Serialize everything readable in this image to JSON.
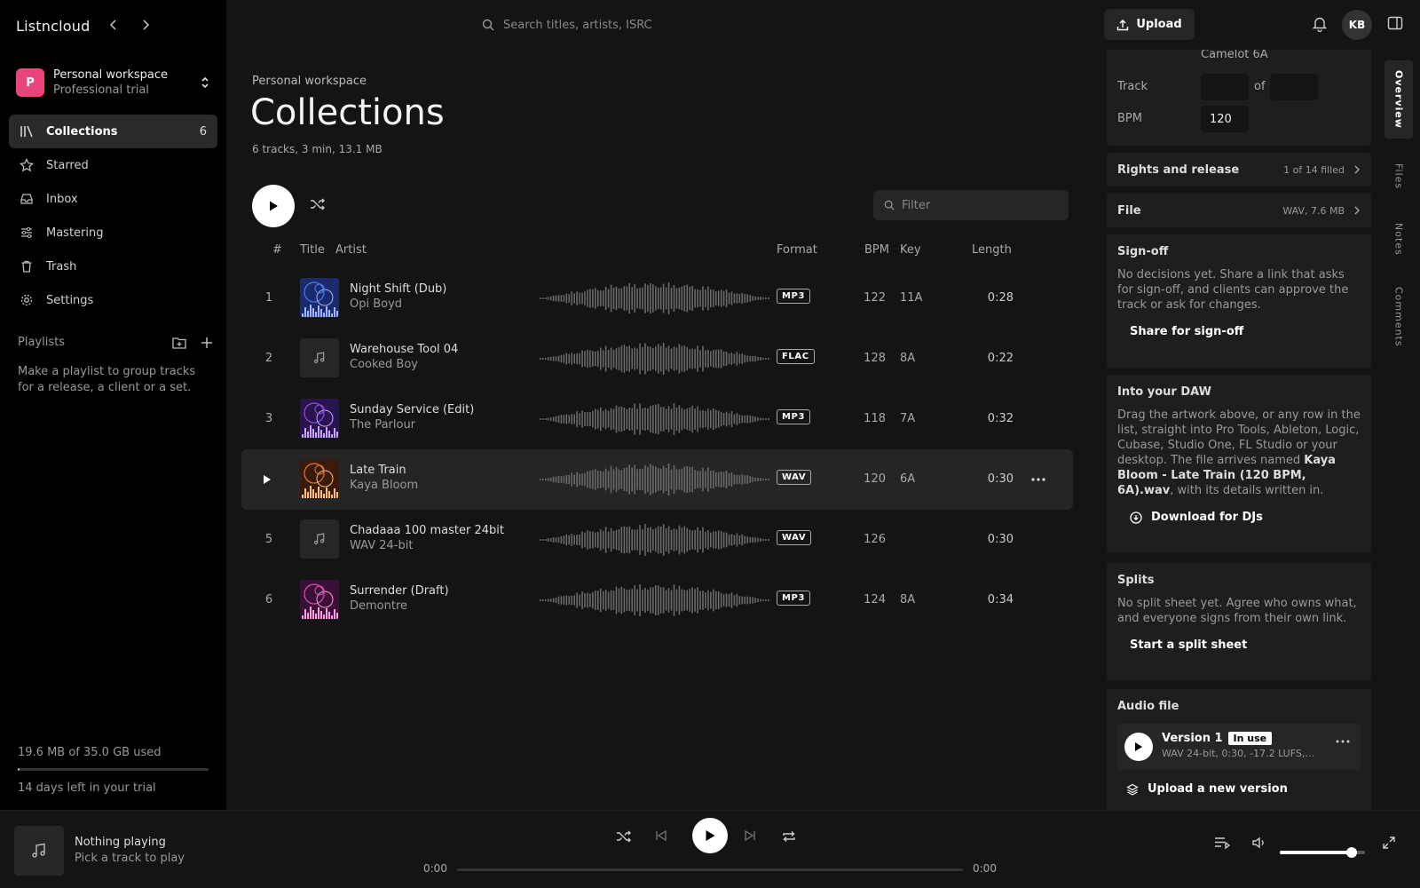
{
  "app": {
    "name": "Listncloud"
  },
  "workspace": {
    "avatar": "P",
    "name": "Personal workspace",
    "plan": "Professional trial"
  },
  "nav": [
    {
      "label": "Collections",
      "count": "6",
      "icon": "collections-icon",
      "active": true
    },
    {
      "label": "Starred",
      "icon": "star-icon"
    },
    {
      "label": "Inbox",
      "icon": "inbox-icon"
    },
    {
      "label": "Mastering",
      "icon": "sliders-icon"
    },
    {
      "label": "Trash",
      "icon": "trash-icon"
    },
    {
      "label": "Settings",
      "icon": "gear-icon"
    }
  ],
  "playlists": {
    "heading": "Playlists",
    "empty": "Make a playlist to group tracks for a release, a client or a set."
  },
  "storage": {
    "used": "19.6 MB of 35.0 GB used",
    "fraction": 0.0006,
    "trial": "14 days left in your trial"
  },
  "search": {
    "placeholder": "Search titles, artists, ISRC"
  },
  "page": {
    "breadcrumb": "Personal workspace",
    "title": "Collections",
    "summary": "6 tracks, 3 min, 13.1 MB"
  },
  "filter": {
    "placeholder": "Filter"
  },
  "columns": {
    "num": "#",
    "title": "Title",
    "artist": "Artist",
    "format": "Format",
    "bpm": "BPM",
    "key": "Key",
    "length": "Length"
  },
  "tracks": [
    {
      "num": "1",
      "title": "Night Shift (Dub)",
      "artist": "Opi Boyd",
      "format": "MP3",
      "bpm": "122",
      "key": "11A",
      "length": "0:28",
      "art": "blue"
    },
    {
      "num": "2",
      "title": "Warehouse Tool 04",
      "artist": "Cooked Boy",
      "format": "FLAC",
      "bpm": "128",
      "key": "8A",
      "length": "0:22",
      "art": "none"
    },
    {
      "num": "3",
      "title": "Sunday Service (Edit)",
      "artist": "The Parlour",
      "format": "MP3",
      "bpm": "118",
      "key": "7A",
      "length": "0:32",
      "art": "purple"
    },
    {
      "num": "4",
      "title": "Late Train",
      "artist": "Kaya Bloom",
      "format": "WAV",
      "bpm": "120",
      "key": "6A",
      "length": "0:30",
      "art": "orange",
      "selected": true
    },
    {
      "num": "5",
      "title": "Chadaaa 100 master 24bit",
      "artist": "WAV 24-bit",
      "format": "WAV",
      "bpm": "126",
      "key": "",
      "length": "0:30",
      "art": "none"
    },
    {
      "num": "6",
      "title": "Surrender (Draft)",
      "artist": "Demontre",
      "format": "MP3",
      "bpm": "124",
      "key": "8A",
      "length": "0:34",
      "art": "pink"
    }
  ],
  "header": {
    "upload": "Upload",
    "user_initials": "KB"
  },
  "details": {
    "camelot": "Camelot 6A",
    "track_label": "Track",
    "of_label": "of",
    "bpm_label": "BPM",
    "bpm_value": "120",
    "rights": {
      "title": "Rights and release",
      "status": "1 of 14 filled"
    },
    "file": {
      "title": "File",
      "status": "WAV, 7.6 MB"
    },
    "signoff": {
      "title": "Sign-off",
      "text": "No decisions yet. Share a link that asks for sign-off, and clients can approve the track or ask for changes.",
      "action": "Share for sign-off"
    },
    "daw": {
      "title": "Into your DAW",
      "text_a": "Drag the artwork above, or any row in the list, straight into Pro Tools, Ableton, Logic, Cubase, Studio One, FL Studio or your desktop. The file arrives named ",
      "filename": "Kaya Bloom - Late Train (120 BPM, 6A).wav",
      "text_b": ", with its details written in.",
      "action": "Download for DJs"
    },
    "splits": {
      "title": "Splits",
      "text": "No split sheet yet. Agree who owns what, and everyone signs from their own link.",
      "action": "Start a split sheet"
    },
    "audio": {
      "title": "Audio file",
      "version": "Version 1",
      "badge": "In use",
      "meta": "WAV 24-bit, 0:30, -17.2 LUFS, K...",
      "action": "Upload a new version"
    }
  },
  "tabs": [
    "Overview",
    "Files",
    "Notes",
    "Comments"
  ],
  "player": {
    "title": "Nothing playing",
    "subtitle": "Pick a track to play",
    "current": "0:00",
    "total": "0:00",
    "volume": 0.84
  }
}
